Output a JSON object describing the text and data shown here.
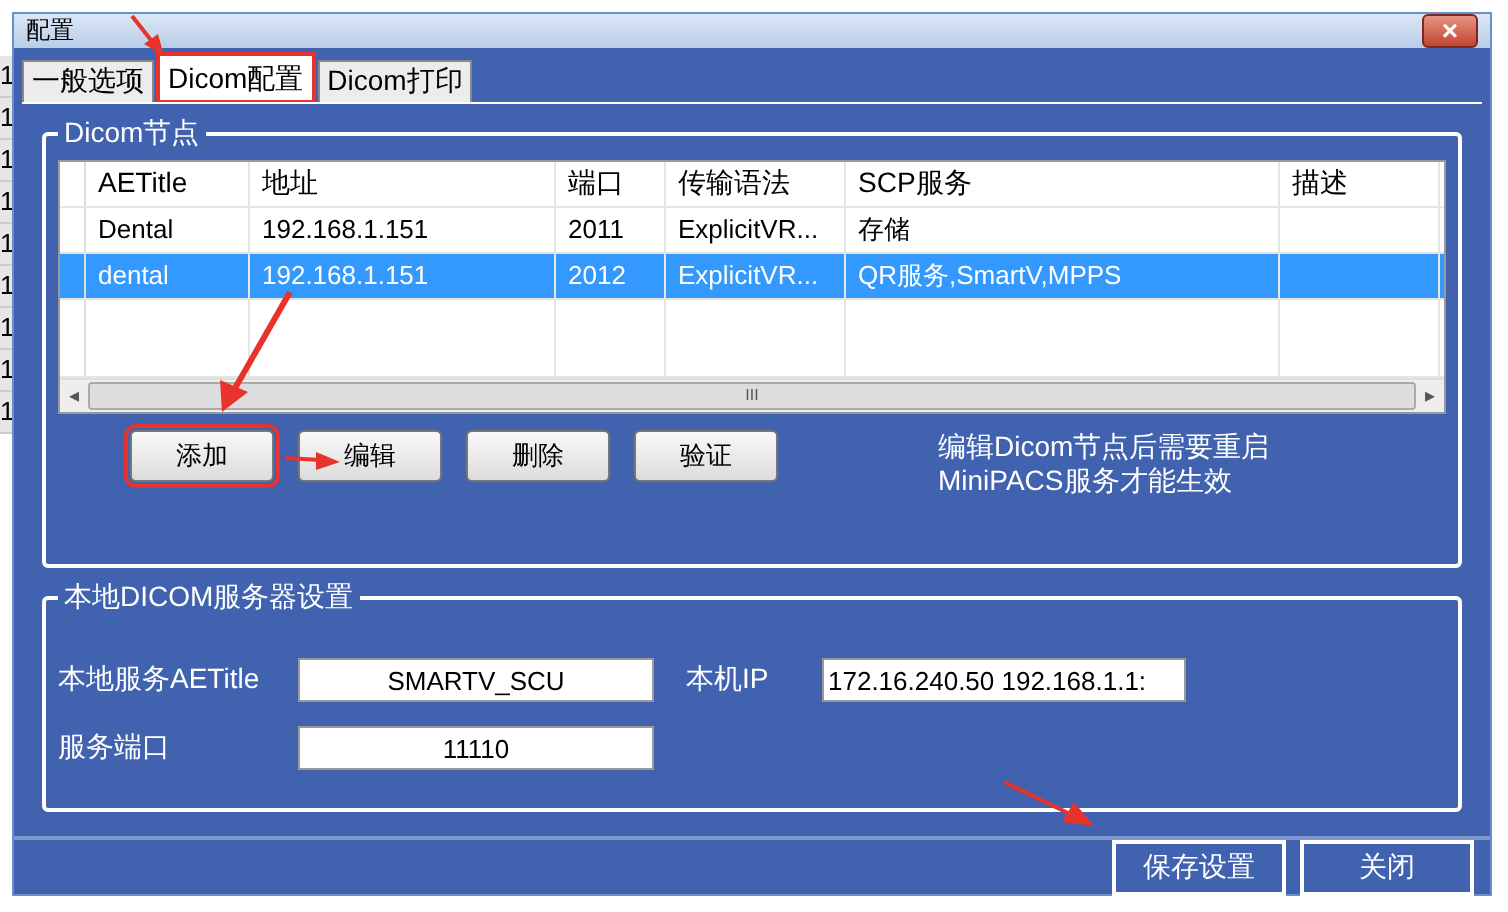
{
  "background_rows": [
    "1",
    "1",
    "1",
    "1",
    "1",
    "1",
    "1",
    "1",
    "1"
  ],
  "window": {
    "title": "配置",
    "close": "×"
  },
  "tabs": [
    {
      "label": "一般选项",
      "selected": false,
      "highlighted": false
    },
    {
      "label": "Dicom配置",
      "selected": true,
      "highlighted": true
    },
    {
      "label": "Dicom打印",
      "selected": false,
      "highlighted": false
    }
  ],
  "nodes_group": {
    "title": "Dicom节点",
    "table": {
      "columns": [
        "AETitle",
        "地址",
        "端口",
        "传输语法",
        "SCP服务",
        "描述"
      ],
      "rows": [
        {
          "cells": [
            "Dental",
            "192.168.1.151",
            "2011",
            "ExplicitVR...",
            "存储",
            ""
          ],
          "selected": false
        },
        {
          "cells": [
            "dental",
            "192.168.1.151",
            "2012",
            "ExplicitVR...",
            "QR服务,SmartV,MPPS",
            ""
          ],
          "selected": true
        }
      ],
      "scroll_left": "◂",
      "scroll_right": "▸",
      "scroll_grip": "III"
    },
    "buttons": [
      {
        "label": "添加",
        "highlighted": true
      },
      {
        "label": "编辑",
        "highlighted": false
      },
      {
        "label": "删除",
        "highlighted": false
      },
      {
        "label": "验证",
        "highlighted": false
      }
    ],
    "note": [
      "编辑Dicom节点后需要重启",
      "MiniPACS服务才能生效"
    ]
  },
  "server_group": {
    "title": "本地DICOM服务器设置",
    "ae_title": {
      "label": "本地服务AETitle",
      "value": "SMARTV_SCU"
    },
    "local_ip": {
      "label": "本机IP",
      "value": "172.16.240.50 192.168.1.1:"
    },
    "port": {
      "label": "服务端口",
      "value": "11110"
    }
  },
  "footer_buttons": [
    {
      "label": "保存设置"
    },
    {
      "label": "关闭"
    }
  ]
}
